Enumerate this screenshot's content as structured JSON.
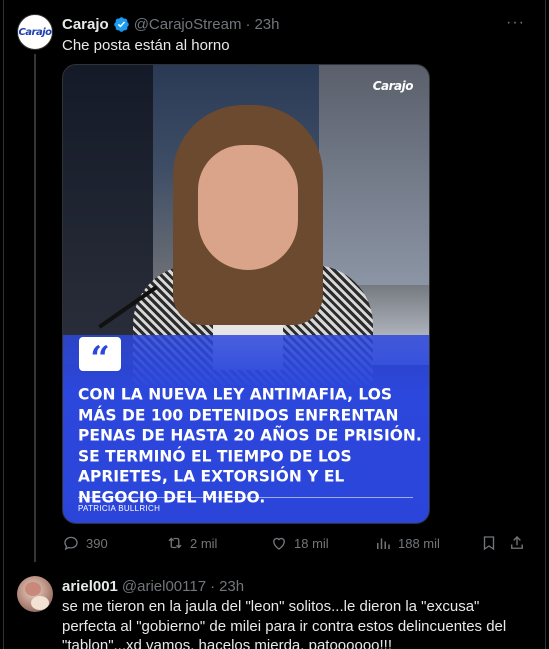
{
  "tweet": {
    "author_name": "Carajo",
    "handle": "@CarajoStream",
    "separator": "·",
    "time": "23h",
    "text": "Che posta están al horno",
    "avatar_logo": "Carajo",
    "verified_icon": "verified-badge-icon",
    "more_icon": "···"
  },
  "media": {
    "logo": "Carajo",
    "quote_mark": "“",
    "quote": "CON LA NUEVA LEY ANTIMAFIA, LOS MÁS DE 100 DETENIDOS ENFRENTAN PENAS DE HASTA 20 AÑOS DE PRISIÓN. SE TERMINÓ EL TIEMPO DE LOS APRIETES, LA EXTORSIÓN Y EL NEGOCIO DEL MIEDO.",
    "author": "PATRICIA BULLRICH",
    "quote_color": "#2c47dc"
  },
  "actions": {
    "replies": "390",
    "reposts": "2 mil",
    "likes": "18 mil",
    "views": "188 mil",
    "icons": [
      "reply-icon",
      "repost-icon",
      "like-icon",
      "views-icon",
      "bookmark-icon",
      "share-icon"
    ]
  },
  "reply": {
    "author_name": "ariel001",
    "handle": "@ariel00117",
    "separator": "·",
    "time": "23h",
    "text": "se me tieron en la jaula del \"leon\" solitos...le dieron la \"excusa\" perfecta al \"gobierno\" de milei para ir contra estos delincuentes del \"tablon\"...xd vamos, hacelos mierda, patoooooo!!!"
  },
  "colors": {
    "background": "#000000",
    "text": "#e7e9ea",
    "secondary": "#71767b",
    "verified": "#1d9bf0"
  }
}
